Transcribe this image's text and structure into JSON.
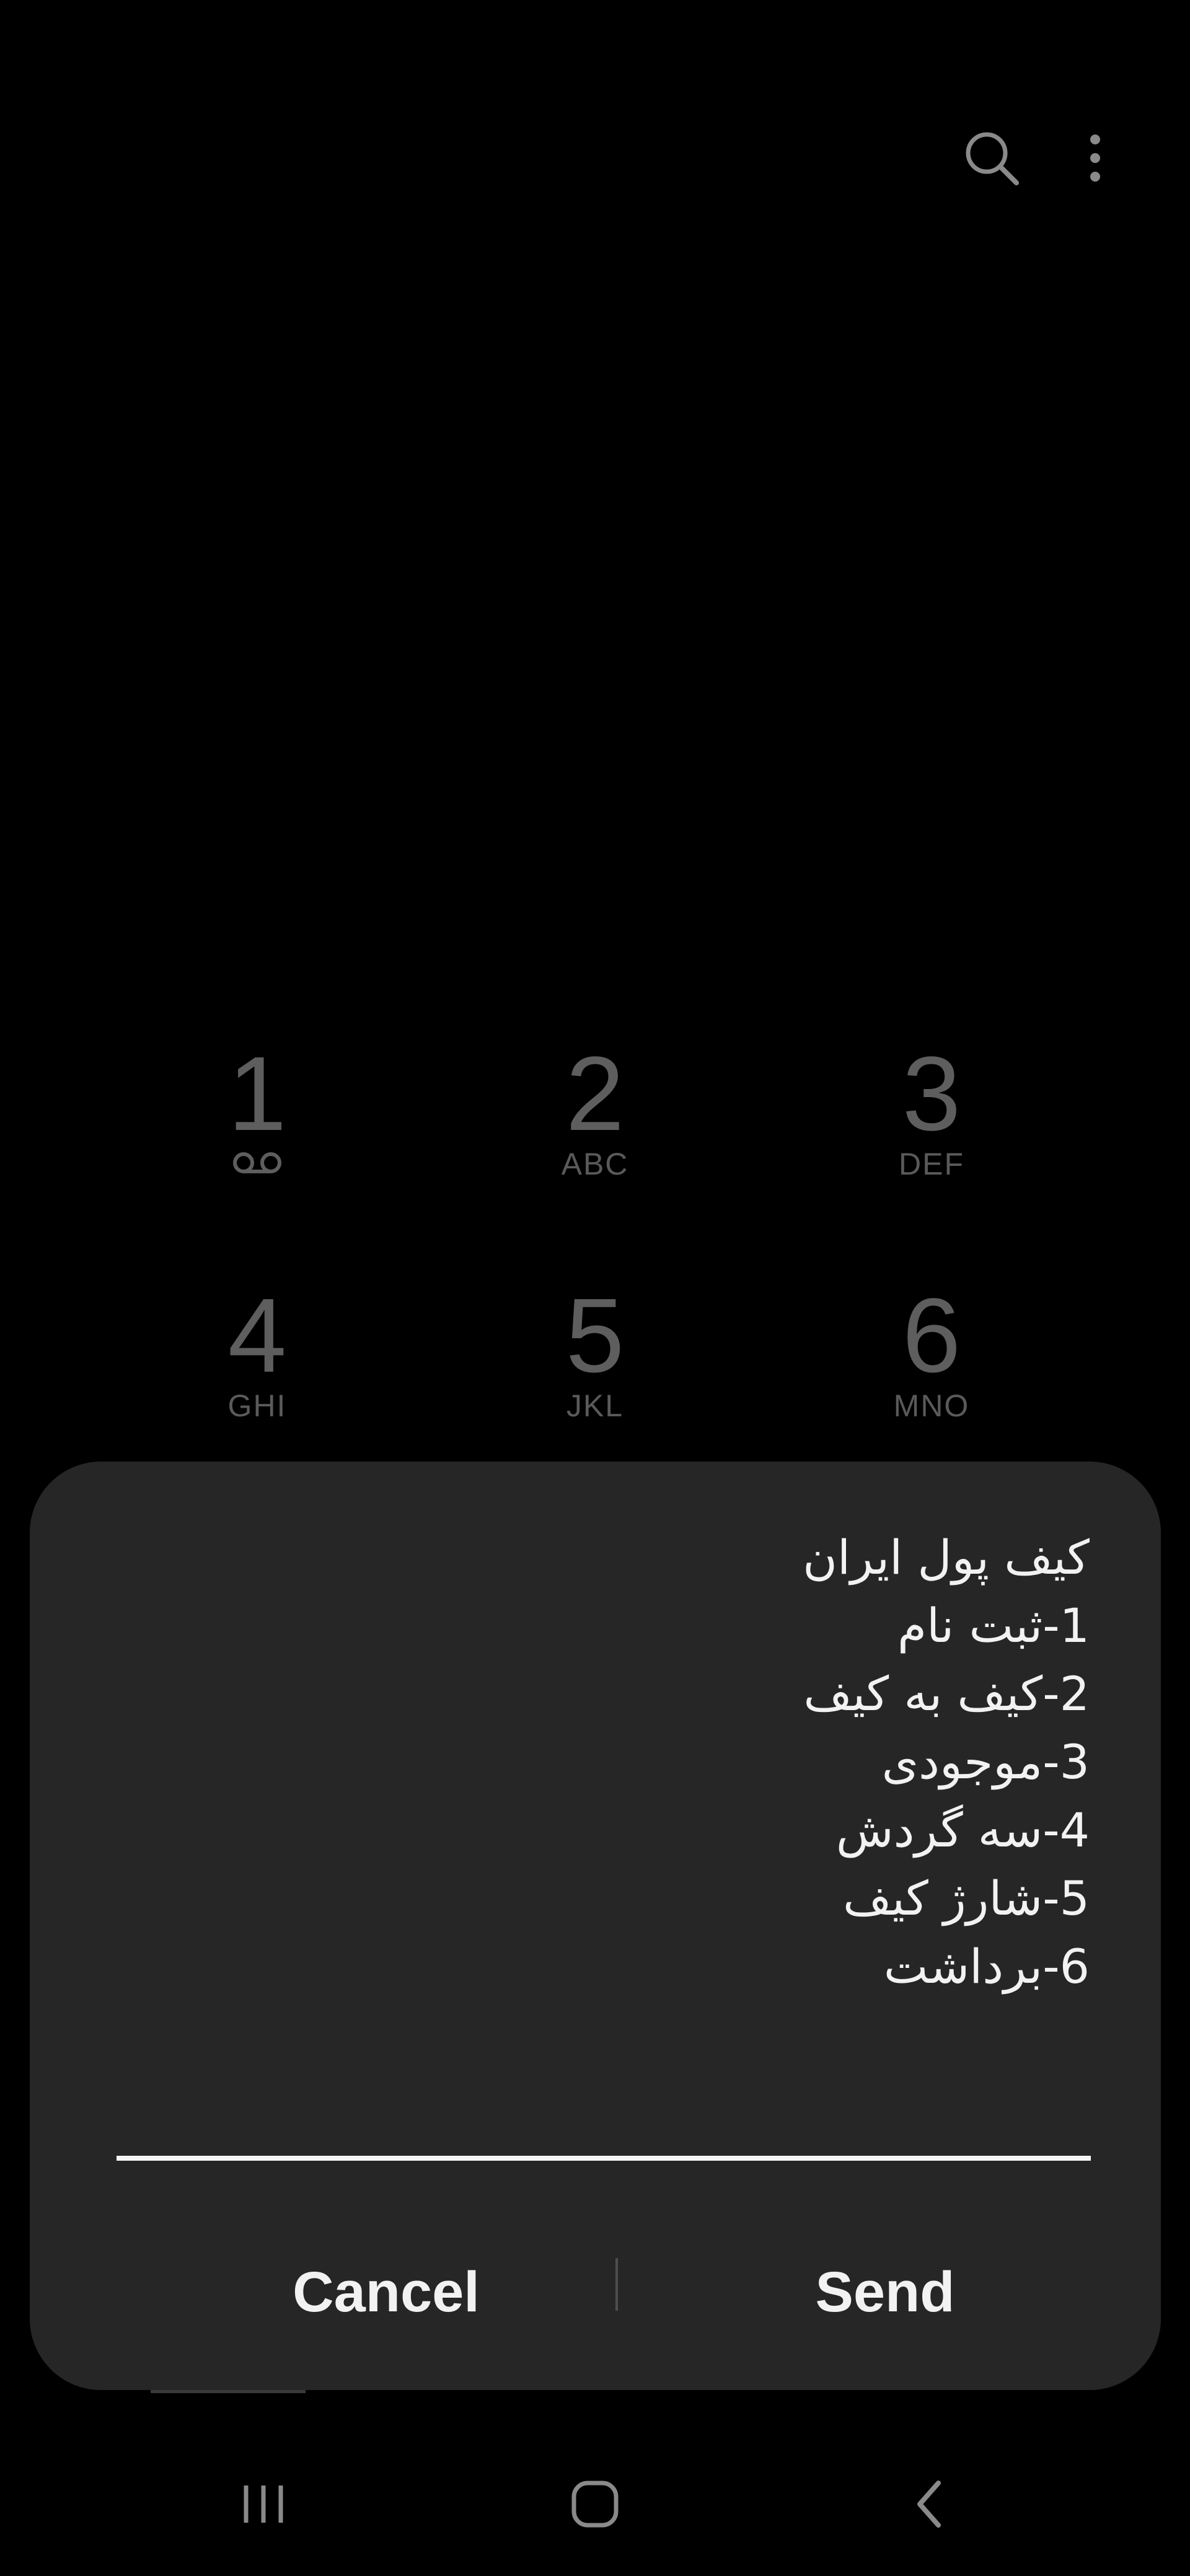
{
  "header": {
    "search_icon": "search-icon",
    "more_icon": "more-options-icon"
  },
  "dialpad": {
    "keys": [
      {
        "digit": "1",
        "letters": "",
        "icon": "voicemail-icon"
      },
      {
        "digit": "2",
        "letters": "ABC"
      },
      {
        "digit": "3",
        "letters": "DEF"
      },
      {
        "digit": "4",
        "letters": "GHI"
      },
      {
        "digit": "5",
        "letters": "JKL"
      },
      {
        "digit": "6",
        "letters": "MNO"
      }
    ]
  },
  "dialog": {
    "message_lines": [
      "کیف پول ایران",
      "1-ثبت نام",
      "2-کیف به کیف",
      "3-موجودی",
      "4-سه گردش",
      "5-شارژ کیف",
      "6-برداشت"
    ],
    "reply_value": "",
    "cancel_label": "Cancel",
    "send_label": "Send"
  },
  "navbar": {
    "recents_icon": "recents-icon",
    "home_icon": "home-icon",
    "back_icon": "back-icon"
  },
  "colors": {
    "background": "#000000",
    "dialog_background": "#262626",
    "dialpad_text": "#5e5e5e",
    "dialog_text": "#f2f2f2",
    "icon_gray": "#8a8a8a"
  }
}
